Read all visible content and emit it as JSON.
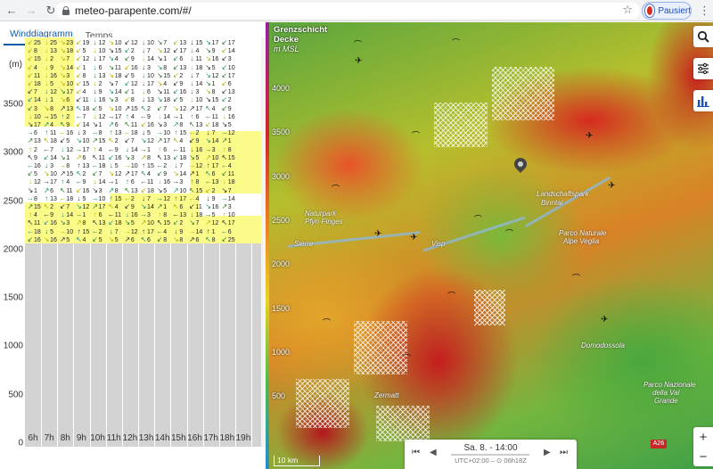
{
  "browser": {
    "url": "meteo-parapente.com/#/",
    "profile_label": "Pausiert"
  },
  "tabs": [
    {
      "label": "Winddiagramm",
      "active": true
    },
    {
      "label": "Temps",
      "active": false
    }
  ],
  "diagram": {
    "unit": "(m)",
    "y_ticks": [
      "3500",
      "3000",
      "2500",
      "2000",
      "1500",
      "1000",
      "500",
      "0"
    ],
    "x_ticks": [
      "6h",
      "7h",
      "8h",
      "9h",
      "10h",
      "11h",
      "12h",
      "13h",
      "14h",
      "15h",
      "16h",
      "17h",
      "18h",
      "19h"
    ],
    "top_speeds": [
      "25",
      "25",
      "23",
      "19",
      "12",
      "10",
      "12",
      "10",
      "7",
      "13",
      "15",
      "17",
      "17"
    ],
    "bottom_speeds": [
      "16",
      "16",
      "5",
      "4",
      "5",
      "5",
      "6",
      "6",
      "8",
      "8",
      "6",
      "8",
      "25"
    ]
  },
  "map": {
    "title_line1": "Grenzschicht",
    "title_line2": "Decke",
    "subtitle": "m MSL",
    "scale_ticks": [
      "4000",
      "3500",
      "3000",
      "2500",
      "2000",
      "1500",
      "1000",
      "500"
    ],
    "scale_label": "10 km",
    "road_badge": "A26",
    "labels": [
      {
        "text": "Landschaftspark",
        "x": 300,
        "y": 188
      },
      {
        "text": "Binntal",
        "x": 305,
        "y": 198
      },
      {
        "text": "Naturpark",
        "x": 40,
        "y": 210
      },
      {
        "text": "Pfyn-Finges",
        "x": 40,
        "y": 219
      },
      {
        "text": "Parco Naturale",
        "x": 325,
        "y": 232
      },
      {
        "text": "Alpe Veglia",
        "x": 330,
        "y": 241
      },
      {
        "text": "Domodossola",
        "x": 350,
        "y": 358
      },
      {
        "text": "Parco Nazionale",
        "x": 420,
        "y": 402
      },
      {
        "text": "della Val",
        "x": 430,
        "y": 411
      },
      {
        "text": "Grande",
        "x": 432,
        "y": 420
      },
      {
        "text": "Zermatt",
        "x": 118,
        "y": 414
      },
      {
        "text": "Sierre",
        "x": 28,
        "y": 244
      },
      {
        "text": "Visp",
        "x": 182,
        "y": 244
      }
    ]
  },
  "time": {
    "date": "Sa. 8. - 14:00",
    "timezone": "UTC+02:00 – ⊙ 06h18Z"
  }
}
